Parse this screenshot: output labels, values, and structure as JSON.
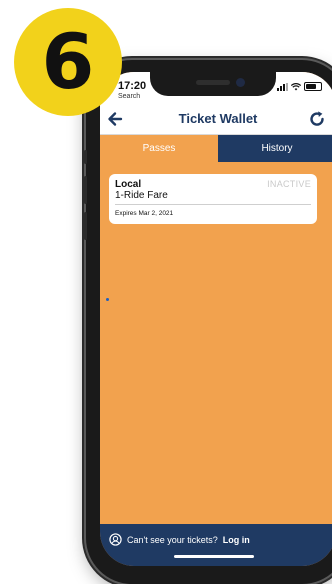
{
  "step": {
    "number": "6"
  },
  "status_bar": {
    "time": "17:20",
    "back_app": "Search"
  },
  "header": {
    "title": "Ticket Wallet",
    "back_icon": "arrow-left-icon",
    "refresh_icon": "refresh-icon"
  },
  "tabs": [
    {
      "label": "Passes",
      "active": true
    },
    {
      "label": "History",
      "active": false
    }
  ],
  "pass": {
    "type": "Local",
    "fare": "1-Ride Fare",
    "status": "INACTIVE",
    "expires": "Expires Mar 2, 2021"
  },
  "footer": {
    "prompt": "Can't see your tickets?",
    "link": "Log in"
  },
  "colors": {
    "accent": "#f2a24e",
    "navy": "#1f3a63",
    "badge": "#f2d21b"
  }
}
